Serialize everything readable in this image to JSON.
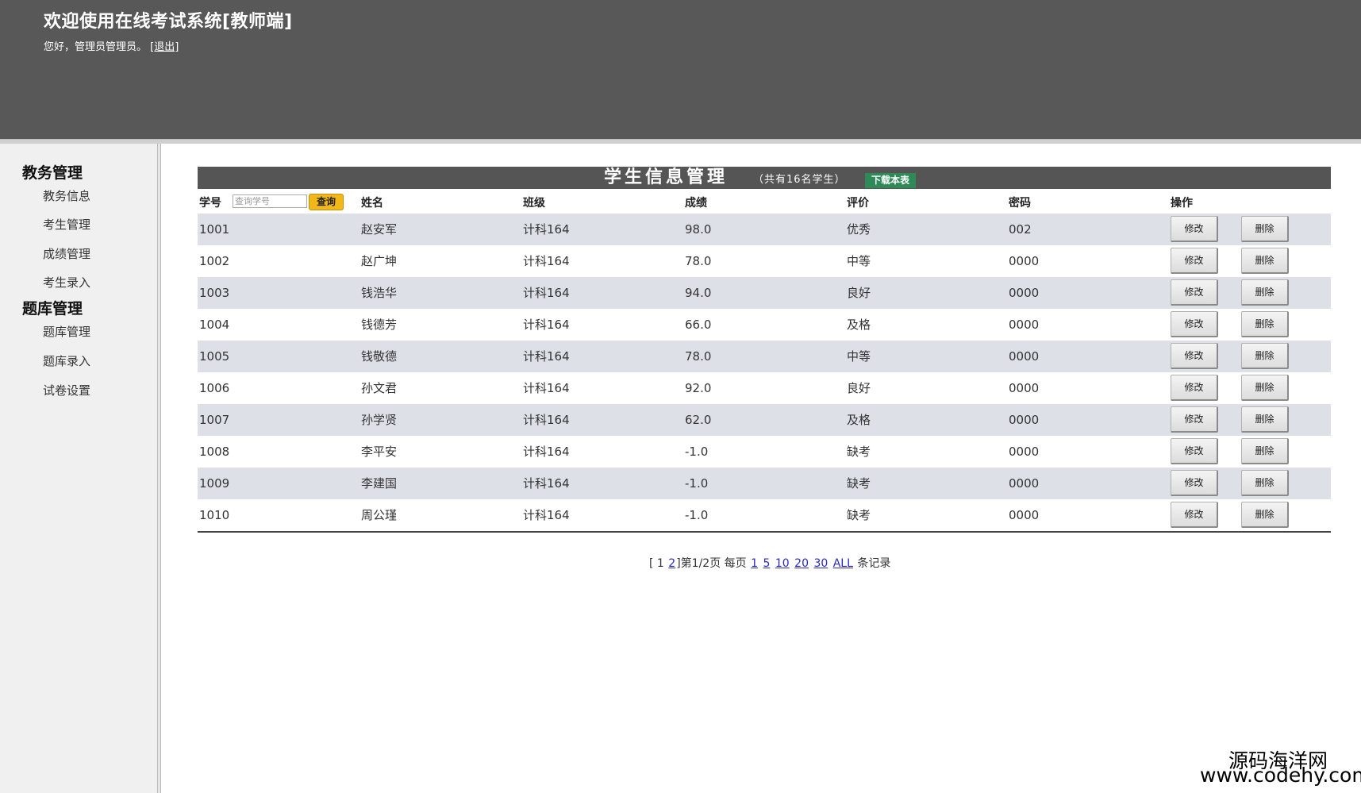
{
  "header": {
    "title": "欢迎使用在线考试系统[教师端]",
    "greeting": "您好，管理员管理员。",
    "logout_label": "[退出]"
  },
  "sidebar": {
    "groups": [
      {
        "label": "教务管理",
        "items": [
          "教务信息",
          "考生管理",
          "成绩管理",
          "考生录入"
        ]
      },
      {
        "label": "题库管理",
        "items": [
          "题库管理",
          "题库录入",
          "试卷设置"
        ]
      }
    ]
  },
  "panel": {
    "title": "学生信息管理",
    "subtitle": "（共有16名学生）",
    "download_label": "下载本表"
  },
  "table": {
    "headers": [
      "学号",
      "姓名",
      "班级",
      "成绩",
      "评价",
      "密码",
      "操作"
    ],
    "search_placeholder": "查询学号",
    "search_button": "查询",
    "edit_label": "修改",
    "delete_label": "删除",
    "rows": [
      [
        "1001",
        "赵安军",
        "计科164",
        "98.0",
        "优秀",
        "002"
      ],
      [
        "1002",
        "赵广坤",
        "计科164",
        "78.0",
        "中等",
        "0000"
      ],
      [
        "1003",
        "钱浩华",
        "计科164",
        "94.0",
        "良好",
        "0000"
      ],
      [
        "1004",
        "钱德芳",
        "计科164",
        "66.0",
        "及格",
        "0000"
      ],
      [
        "1005",
        "钱敬德",
        "计科164",
        "78.0",
        "中等",
        "0000"
      ],
      [
        "1006",
        "孙文君",
        "计科164",
        "92.0",
        "良好",
        "0000"
      ],
      [
        "1007",
        "孙学贤",
        "计科164",
        "62.0",
        "及格",
        "0000"
      ],
      [
        "1008",
        "李平安",
        "计科164",
        "-1.0",
        "缺考",
        "0000"
      ],
      [
        "1009",
        "李建国",
        "计科164",
        "-1.0",
        "缺考",
        "0000"
      ],
      [
        "1010",
        "周公瑾",
        "计科164",
        "-1.0",
        "缺考",
        "0000"
      ]
    ]
  },
  "pager": {
    "open_bracket": "[",
    "current_page": "1",
    "page_link": "2",
    "close_text": "]第1/2页",
    "per_page_label": "每页",
    "size_options": [
      "1",
      "5",
      "10",
      "20",
      "30",
      "ALL"
    ],
    "suffix": "条记录"
  },
  "watermark": {
    "site_name": "源码海洋网",
    "site_url": "www.codehy.com"
  }
}
